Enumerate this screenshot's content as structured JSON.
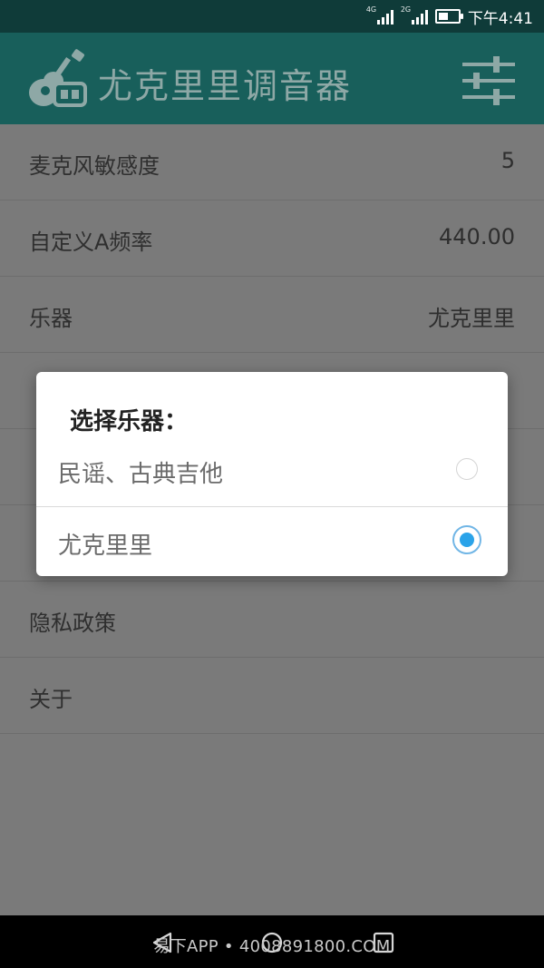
{
  "status_bar": {
    "network_1": "4G",
    "network_2": "2G",
    "time": "下午4:41"
  },
  "app_bar": {
    "title": "尤克里里调音器"
  },
  "settings_list": [
    {
      "label": "麦克风敏感度",
      "value": "5"
    },
    {
      "label": "自定义A频率",
      "value": "440.00"
    },
    {
      "label": "乐器",
      "value": "尤克里里"
    },
    {
      "label": "",
      "value": ""
    },
    {
      "label": "",
      "value": ""
    },
    {
      "label": "",
      "value": ""
    },
    {
      "label": "隐私政策",
      "value": ""
    },
    {
      "label": "关于",
      "value": ""
    }
  ],
  "dialog": {
    "title": "选择乐器：",
    "options": [
      {
        "label": "民谣、古典吉他",
        "selected": false
      },
      {
        "label": "尤克里里",
        "selected": true
      }
    ]
  },
  "watermark": "易下APP • 4008891800.COM",
  "colors": {
    "app_bar": "#185f5b",
    "status_bar": "#0f3b39",
    "radio_selected": "#2aa3e9"
  },
  "icons": {
    "app_logo": "ukulele-icon",
    "settings": "sliders-icon"
  }
}
